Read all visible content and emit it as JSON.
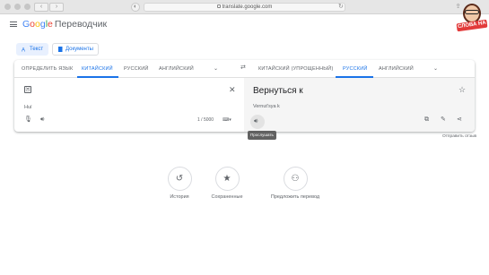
{
  "browser": {
    "url": "translate.google.com"
  },
  "sticker": {
    "label": "СЛОВА НА"
  },
  "header": {
    "logo_letters": [
      "G",
      "o",
      "o",
      "g",
      "l",
      "e"
    ],
    "product": "Переводчик"
  },
  "modes": [
    {
      "label": "Текст",
      "active": true,
      "icon": "text-icon"
    },
    {
      "label": "Документы",
      "active": false,
      "icon": "document-icon"
    }
  ],
  "source_languages": [
    "ОПРЕДЕЛИТЬ ЯЗЫК",
    "КИТАЙСКИЙ",
    "РУССКИЙ",
    "АНГЛИЙСКИЙ"
  ],
  "source_selected": "КИТАЙСКИЙ",
  "target_languages": [
    "КИТАЙСКИЙ (УПРОЩЕННЫЙ)",
    "РУССКИЙ",
    "АНГЛИЙСКИЙ"
  ],
  "target_selected": "РУССКИЙ",
  "source": {
    "input_char": "回",
    "transliteration": "Huí",
    "counter": "1 / 5000"
  },
  "target": {
    "translation": "Вернуться к",
    "transliteration": "Vernut'sya k"
  },
  "tooltip": "Прослушать",
  "feedback": "Отправить отзыв",
  "bottom": [
    {
      "label": "История",
      "icon": "history-icon"
    },
    {
      "label": "Сохраненные",
      "icon": "star-icon"
    },
    {
      "label": "Предложить перевод",
      "icon": "suggest-edit-icon"
    }
  ],
  "colors": {
    "accent": "#1a73e8",
    "active_tab_bg": "#e8f0fe",
    "target_pane_bg": "#f5f5f5"
  }
}
